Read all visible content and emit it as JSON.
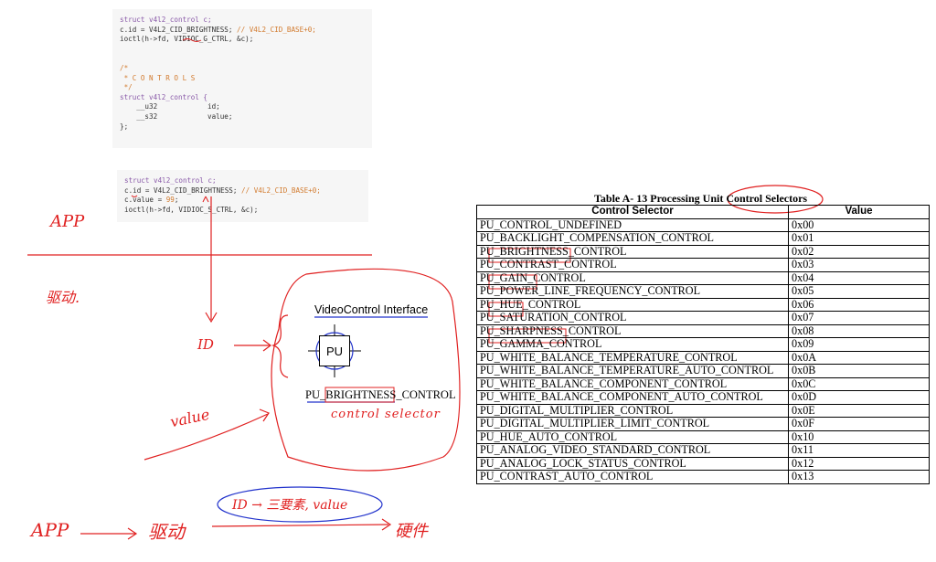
{
  "code_block_1": {
    "lines": [
      [
        {
          "t": "struct v4l2_control c;",
          "c": "kw"
        }
      ],
      [
        {
          "t": "c.id = V4L2_CID_BRIGHTNESS; ",
          "c": "var"
        },
        {
          "t": "// V4L2_CID_BASE+0;",
          "c": "cm"
        }
      ],
      [
        {
          "t": "ioctl(h->fd, VIDIOC_G_CTRL, &c);",
          "c": "var"
        }
      ],
      [
        {
          "t": "",
          "c": "var"
        }
      ],
      [
        {
          "t": "",
          "c": "var"
        }
      ],
      [
        {
          "t": "/*",
          "c": "cm"
        }
      ],
      [
        {
          "t": " * C O N T R O L S",
          "c": "cm"
        }
      ],
      [
        {
          "t": " */",
          "c": "cm"
        }
      ],
      [
        {
          "t": "struct v4l2_control {",
          "c": "kw"
        }
      ],
      [
        {
          "t": "    __u32            id;",
          "c": "var"
        }
      ],
      [
        {
          "t": "    __s32            value;",
          "c": "var"
        }
      ],
      [
        {
          "t": "};",
          "c": "var"
        }
      ]
    ]
  },
  "code_block_2": {
    "lines": [
      [
        {
          "t": "struct v4l2_control c;",
          "c": "kw"
        }
      ],
      [
        {
          "t": "c.id = V4L2_CID_BRIGHTNESS; ",
          "c": "var"
        },
        {
          "t": "// V4L2_CID_BASE+0;",
          "c": "cm"
        }
      ],
      [
        {
          "t": "c.value = ",
          "c": "var"
        },
        {
          "t": "99",
          "c": "nm"
        },
        {
          "t": ";",
          "c": "var"
        }
      ],
      [
        {
          "t": "ioctl(h->fd, VIDIOC_S_CTRL, &c);",
          "c": "var"
        }
      ]
    ]
  },
  "handwriting": {
    "app_top": "APP",
    "driver_left": "驱动.",
    "id_label": "ID",
    "value_label": "value",
    "control_selector": "control selector",
    "app_bottom": "APP",
    "driver_bottom": "驱动",
    "bubble": "ID → 三要素, value",
    "hardware": "硬件"
  },
  "diagram": {
    "title": "VideoControl Interface",
    "unit": "PU",
    "selector": "PU_BRIGHTNESS_CONTROL"
  },
  "table": {
    "caption": "Table A- 13 Processing Unit Control Selectors",
    "headers": [
      "Control Selector",
      "Value"
    ],
    "rows": [
      [
        "PU_CONTROL_UNDEFINED",
        "0x00"
      ],
      [
        "PU_BACKLIGHT_COMPENSATION_CONTROL",
        "0x01"
      ],
      [
        "PU_BRIGHTNESS_CONTROL",
        "0x02"
      ],
      [
        "PU_CONTRAST_CONTROL",
        "0x03"
      ],
      [
        "PU_GAIN_CONTROL",
        "0x04"
      ],
      [
        "PU_POWER_LINE_FREQUENCY_CONTROL",
        "0x05"
      ],
      [
        "PU_HUE_CONTROL",
        "0x06"
      ],
      [
        "PU_SATURATION_CONTROL",
        "0x07"
      ],
      [
        "PU_SHARPNESS_CONTROL",
        "0x08"
      ],
      [
        "PU_GAMMA_CONTROL",
        "0x09"
      ],
      [
        "PU_WHITE_BALANCE_TEMPERATURE_CONTROL",
        "0x0A"
      ],
      [
        "PU_WHITE_BALANCE_TEMPERATURE_AUTO_CONTROL",
        "0x0B"
      ],
      [
        "PU_WHITE_BALANCE_COMPONENT_CONTROL",
        "0x0C"
      ],
      [
        "PU_WHITE_BALANCE_COMPONENT_AUTO_CONTROL",
        "0x0D"
      ],
      [
        "PU_DIGITAL_MULTIPLIER_CONTROL",
        "0x0E"
      ],
      [
        "PU_DIGITAL_MULTIPLIER_LIMIT_CONTROL",
        "0x0F"
      ],
      [
        "PU_HUE_AUTO_CONTROL",
        "0x10"
      ],
      [
        "PU_ANALOG_VIDEO_STANDARD_CONTROL",
        "0x11"
      ],
      [
        "PU_ANALOG_LOCK_STATUS_CONTROL",
        "0x12"
      ],
      [
        "PU_CONTRAST_AUTO_CONTROL",
        "0x13"
      ]
    ]
  },
  "colors": {
    "ink_red": "#e02020",
    "ink_blue": "#2233cc"
  }
}
